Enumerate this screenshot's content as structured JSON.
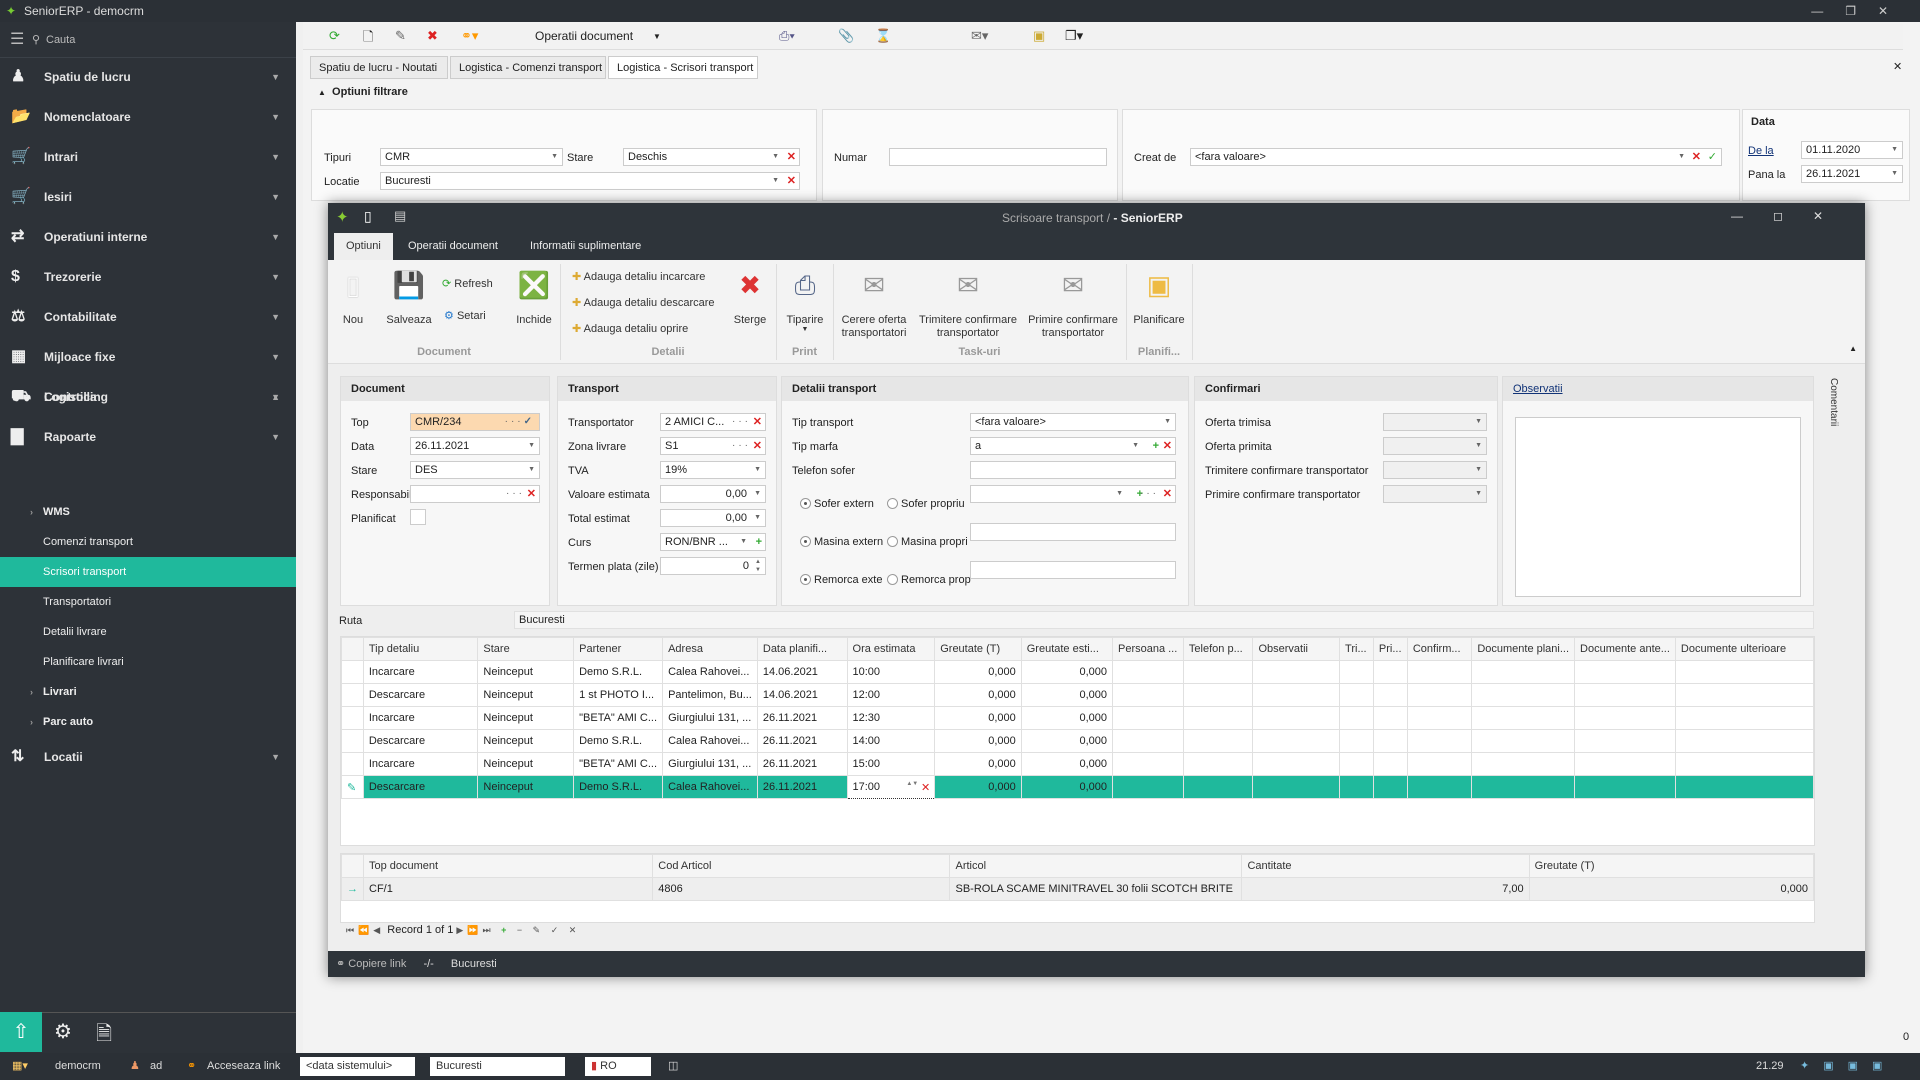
{
  "app": {
    "title": "SeniorERP - democrm"
  },
  "sidebar": {
    "search_placeholder": "Cauta",
    "items": [
      {
        "label": "Spatiu de lucru",
        "icon": "workspace-icon"
      },
      {
        "label": "Nomenclatoare",
        "icon": "folder-icon"
      },
      {
        "label": "Intrari",
        "icon": "cart-in-icon"
      },
      {
        "label": "Iesiri",
        "icon": "cart-out-icon"
      },
      {
        "label": "Operatiuni interne",
        "icon": "transfer-icon"
      },
      {
        "label": "Trezorerie",
        "icon": "money-icon"
      },
      {
        "label": "Contabilitate",
        "icon": "scale-icon"
      },
      {
        "label": "Mijloace fixe",
        "icon": "building-icon"
      },
      {
        "label": "Controlling",
        "icon": "trend-icon"
      },
      {
        "label": "Rapoarte",
        "icon": "bar-chart-icon"
      },
      {
        "label": "Logistica",
        "icon": "truck-icon"
      }
    ],
    "sub_items": [
      {
        "label": "WMS",
        "expandable": true
      },
      {
        "label": "Comenzi transport"
      },
      {
        "label": "Scrisori transport",
        "selected": true
      },
      {
        "label": "Transportatori"
      },
      {
        "label": "Detalii livrare"
      },
      {
        "label": "Planificare livrari"
      },
      {
        "label": "Livrari",
        "expandable": true
      },
      {
        "label": "Parc auto",
        "expandable": true
      }
    ],
    "last_item": {
      "label": "Locatii",
      "icon": "pin-icon"
    }
  },
  "toolbar": {
    "operations_label": "Operatii document"
  },
  "tabs": [
    {
      "label": "Spatiu de lucru - Noutati"
    },
    {
      "label": "Logistica - Comenzi transport"
    },
    {
      "label": "Logistica - Scrisori transport",
      "active": true
    }
  ],
  "filters": {
    "title": "Optiuni filtrare",
    "tipuri_label": "Tipuri",
    "tipuri": "CMR",
    "stare_label": "Stare",
    "stare": "Deschis",
    "locatie_label": "Locatie",
    "locatie": "Bucuresti",
    "numar_label": "Numar",
    "numar": "",
    "creat_label": "Creat de",
    "creat": "<fara valoare>",
    "data_title": "Data",
    "dela_label": "De la",
    "dela": "01.11.2020",
    "panala_label": "Pana la",
    "panala": "26.11.2021"
  },
  "modal": {
    "title_prefix": "Scrisoare transport / ",
    "title_app": "- SeniorERP",
    "tabs": [
      {
        "label": "Optiuni",
        "active": true
      },
      {
        "label": "Operatii document"
      },
      {
        "label": "Informatii suplimentare"
      }
    ],
    "ribbon": {
      "nou": "Nou",
      "salveaza": "Salveaza",
      "refresh": "Refresh",
      "setari": "Setari",
      "inchide": "Inchide",
      "add_incarcare": "Adauga detaliu incarcare",
      "add_descarcare": "Adauga detaliu descarcare",
      "add_oprire": "Adauga detaliu oprire",
      "sterge": "Sterge",
      "tiparire": "Tiparire",
      "cerere": "Cerere oferta transportatori",
      "trimitere": "Trimitere confirmare transportator",
      "primire": "Primire confirmare transportator",
      "planificare": "Planificare",
      "groups": {
        "document": "Document",
        "detalii": "Detalii",
        "print": "Print",
        "task": "Task-uri",
        "planifi": "Planifi..."
      }
    },
    "document": {
      "title": "Document",
      "top_label": "Top",
      "top": "CMR/234",
      "data_label": "Data",
      "data": "26.11.2021",
      "stare_label": "Stare",
      "stare": "DES",
      "resp_label": "Responsabil",
      "resp": "",
      "planificat_label": "Planificat",
      "planificat": false
    },
    "transport": {
      "title": "Transport",
      "transportator_label": "Transportator",
      "transportator": "2 AMICI C...",
      "zona_label": "Zona livrare",
      "zona": "S1",
      "tva_label": "TVA",
      "tva": "19%",
      "valoare_label": "Valoare estimata",
      "valoare": "0,00",
      "total_label": "Total estimat",
      "total": "0,00",
      "curs_label": "Curs",
      "curs": "RON/BNR ...",
      "termen_label": "Termen plata (zile)",
      "termen": "0"
    },
    "detalii": {
      "title": "Detalii transport",
      "tip_transport_label": "Tip transport",
      "tip_transport": "<fara valoare>",
      "tip_marfa_label": "Tip marfa",
      "tip_marfa": "a",
      "telefon_label": "Telefon sofer",
      "telefon": "",
      "sofer_extern": "Sofer extern",
      "sofer_propriu": "Sofer propriu",
      "masina_externa": "Masina extern",
      "masina_proprie": "Masina propri",
      "remorca_externa": "Remorca exte",
      "remorca_proprie": "Remorca prop"
    },
    "confirmari": {
      "title": "Confirmari",
      "oferta_trimisa": "Oferta trimisa",
      "oferta_primita": "Oferta primita",
      "trimitere": "Trimitere confirmare transportator",
      "primire": "Primire confirmare transportator"
    },
    "observatii": {
      "title": "Observatii",
      "side_label": "Comentarii"
    },
    "ruta": {
      "label": "Ruta",
      "value": "Bucuresti"
    },
    "grid": {
      "columns": [
        "Tip detaliu",
        "Stare",
        "Partener",
        "Adresa",
        "Data planifi...",
        "Ora estimata",
        "Greutate (T)",
        "Greutate esti...",
        "Persoana ...",
        "Telefon p...",
        "Observatii",
        "Tri...",
        "Pri...",
        "Confirm...",
        "Documente plani...",
        "Documente ante...",
        "Documente ulterioare"
      ],
      "rows": [
        [
          "Incarcare",
          "Neinceput",
          "Demo S.R.L.",
          "Calea Rahovei...",
          "14.06.2021",
          "10:00",
          "0,000",
          "0,000"
        ],
        [
          "Descarcare",
          "Neinceput",
          "1 st PHOTO I...",
          "Pantelimon, Bu...",
          "14.06.2021",
          "12:00",
          "0,000",
          "0,000"
        ],
        [
          "Incarcare",
          "Neinceput",
          "\"BETA\" AMI C...",
          "Giurgiului 131, ...",
          "26.11.2021",
          "12:30",
          "0,000",
          "0,000"
        ],
        [
          "Descarcare",
          "Neinceput",
          "Demo S.R.L.",
          "Calea Rahovei...",
          "26.11.2021",
          "14:00",
          "0,000",
          "0,000"
        ],
        [
          "Incarcare",
          "Neinceput",
          "\"BETA\" AMI C...",
          "Giurgiului 131, ...",
          "26.11.2021",
          "15:00",
          "0,000",
          "0,000"
        ],
        [
          "Descarcare",
          "Neinceput",
          "Demo S.R.L.",
          "Calea Rahovei...",
          "26.11.2021",
          "17:00",
          "0,000",
          "0,000"
        ]
      ],
      "selected_row": 5
    },
    "subgrid": {
      "columns": [
        "Top document",
        "Cod Articol",
        "Articol",
        "Cantitate",
        "Greutate (T)"
      ],
      "rows": [
        [
          "CF/1",
          "4806",
          "SB-ROLA SCAME MINITRAVEL 30 folii SCOTCH BRITE",
          "7,00",
          "0,000"
        ]
      ]
    },
    "navigator": {
      "record": "Record 1 of 1"
    },
    "footer": {
      "copy_link": "Copiere link",
      "sep": "-/-",
      "location": "Bucuresti"
    }
  },
  "statusbar": {
    "user_db": "democrm",
    "user": "ad",
    "link": "Acceseaza link",
    "date": "<data sistemului>",
    "location": "Bucuresti",
    "lang": "RO",
    "time": "21.29",
    "count": "0"
  },
  "colors": {
    "accent": "#1fb99c",
    "dark": "#2d3238"
  }
}
